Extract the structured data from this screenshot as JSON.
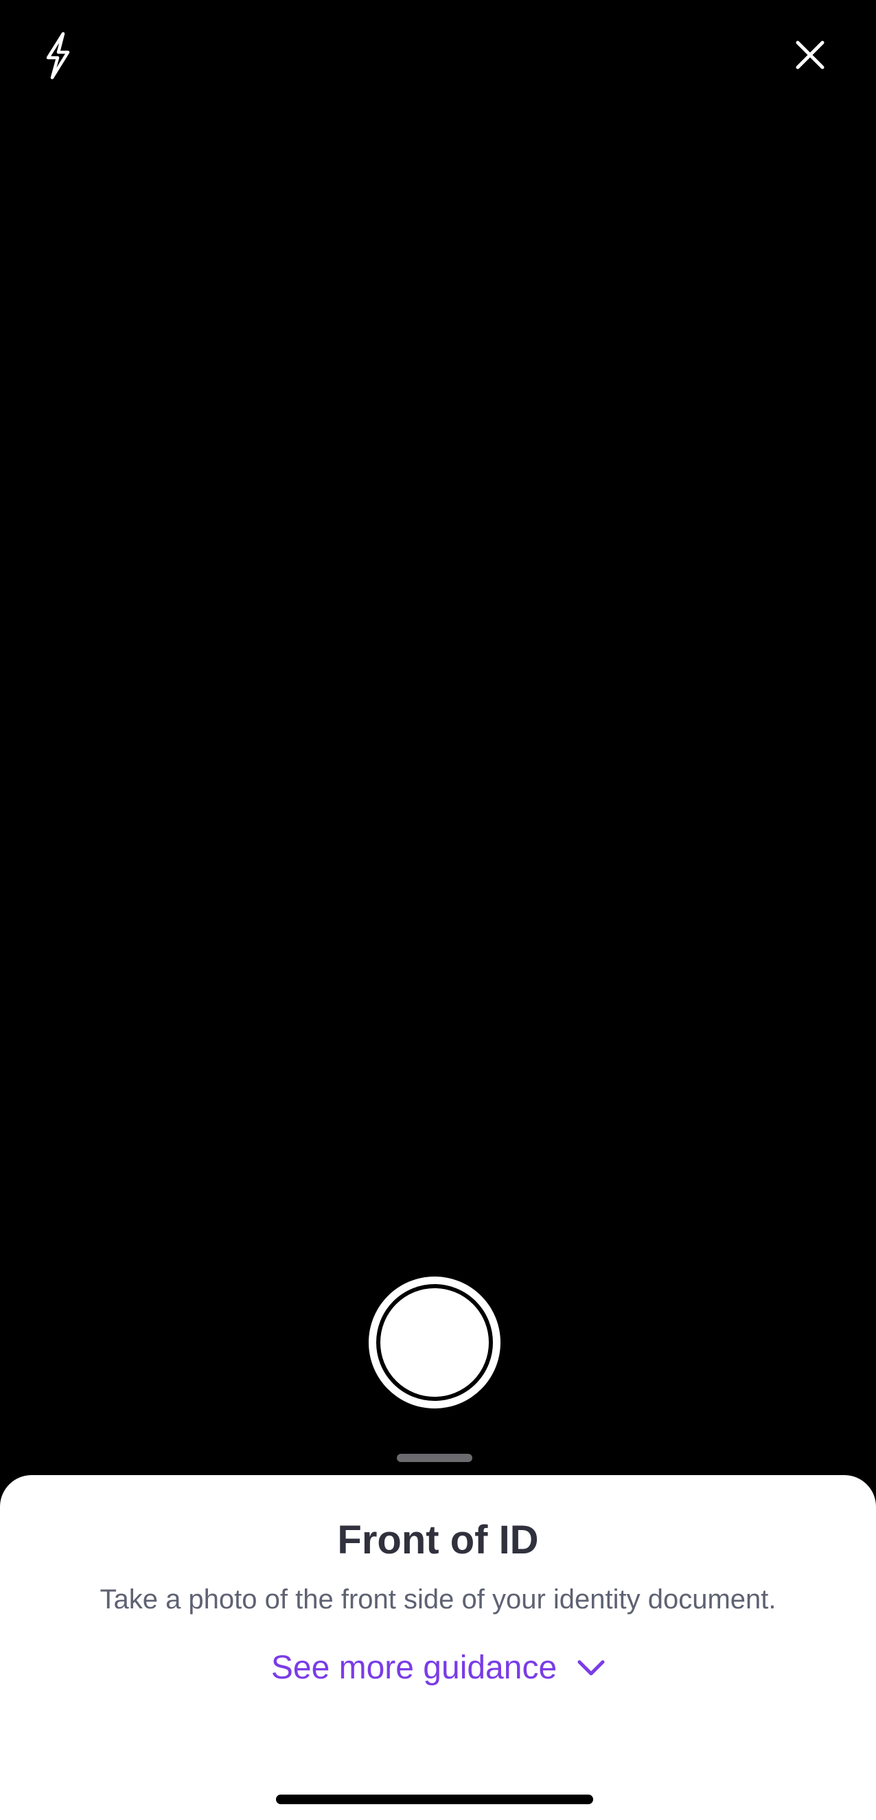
{
  "camera": {
    "flash_icon": "lightning-bolt-icon",
    "close_icon": "close-x-icon",
    "shutter_icon": "shutter-circle"
  },
  "sheet": {
    "title": "Front of ID",
    "subtitle": "Take a photo of the front side of your identity document.",
    "guidance_label": "See more guidance",
    "guidance_icon": "chevron-down-icon"
  },
  "colors": {
    "background": "#000000",
    "sheet_background": "#ffffff",
    "title": "#30313d",
    "subtitle": "#5e6272",
    "accent": "#7a3ce6",
    "grabber": "#6b6b6f"
  }
}
